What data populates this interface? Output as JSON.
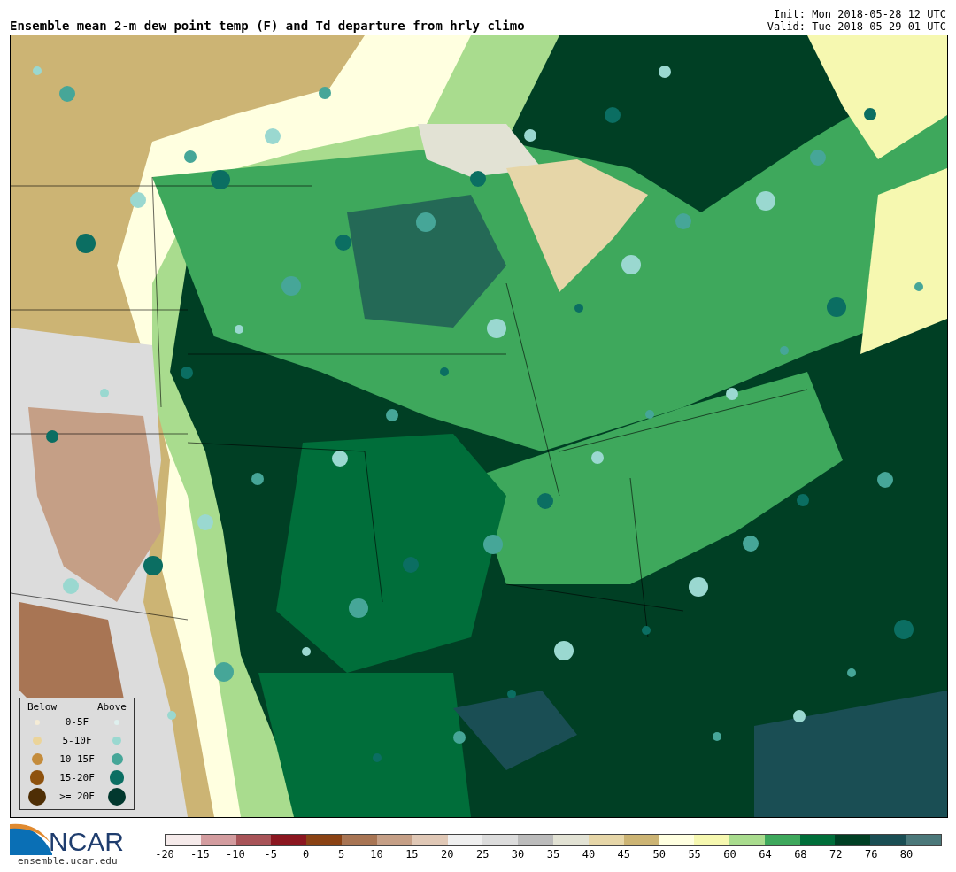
{
  "title": "Ensemble mean 2-m dew point temp (F) and Td departure from hrly climo",
  "init": "Init: Mon 2018-05-28 12 UTC",
  "valid": "Valid: Tue 2018-05-29 01 UTC",
  "legend": {
    "below_heading": "Below",
    "above_heading": "Above",
    "rows": [
      {
        "label": "0-5F",
        "below": {
          "color": "#f5ecd6"
        },
        "above": {
          "color": "#dff0ee"
        }
      },
      {
        "label": "5-10F",
        "below": {
          "color": "#ebd49a"
        },
        "above": {
          "color": "#9ad8d0"
        }
      },
      {
        "label": "10-15F",
        "below": {
          "color": "#c48c3c"
        },
        "above": {
          "color": "#46a698"
        }
      },
      {
        "label": "15-20F",
        "below": {
          "color": "#8e520e"
        },
        "above": {
          "color": "#0b6e62"
        }
      },
      {
        "label": ">= 20F",
        "below": {
          "color": "#4e2e05"
        },
        "above": {
          "color": "#02382e"
        }
      }
    ]
  },
  "logo": {
    "name": "NCAR",
    "url": "ensemble.ucar.edu"
  },
  "colorbar": {
    "bins": [
      {
        "color": "#f5eaea"
      },
      {
        "color": "#d39c9f"
      },
      {
        "color": "#a85458"
      },
      {
        "color": "#8b1620"
      },
      {
        "color": "#8a4214"
      },
      {
        "color": "#a87554"
      },
      {
        "color": "#c59f86"
      },
      {
        "color": "#e0c8b6"
      },
      {
        "color": "#efefef"
      },
      {
        "color": "#dcdcdc"
      },
      {
        "color": "#bbbbbb"
      },
      {
        "color": "#e2e2d4"
      },
      {
        "color": "#e6d6a8"
      },
      {
        "color": "#ccb474"
      },
      {
        "color": "#ffffe0"
      },
      {
        "color": "#f6f8b0"
      },
      {
        "color": "#a9dc8e"
      },
      {
        "color": "#3ea85c"
      },
      {
        "color": "#006e3a"
      },
      {
        "color": "#003f24"
      },
      {
        "color": "#1a4e54"
      },
      {
        "color": "#4b787a"
      }
    ],
    "labels": [
      "-20",
      "-15",
      "-10",
      "-5",
      "0",
      "5",
      "10",
      "15",
      "20",
      "25",
      "30",
      "35",
      "40",
      "45",
      "50",
      "55",
      "60",
      "64",
      "68",
      "72",
      "76",
      "80"
    ]
  }
}
